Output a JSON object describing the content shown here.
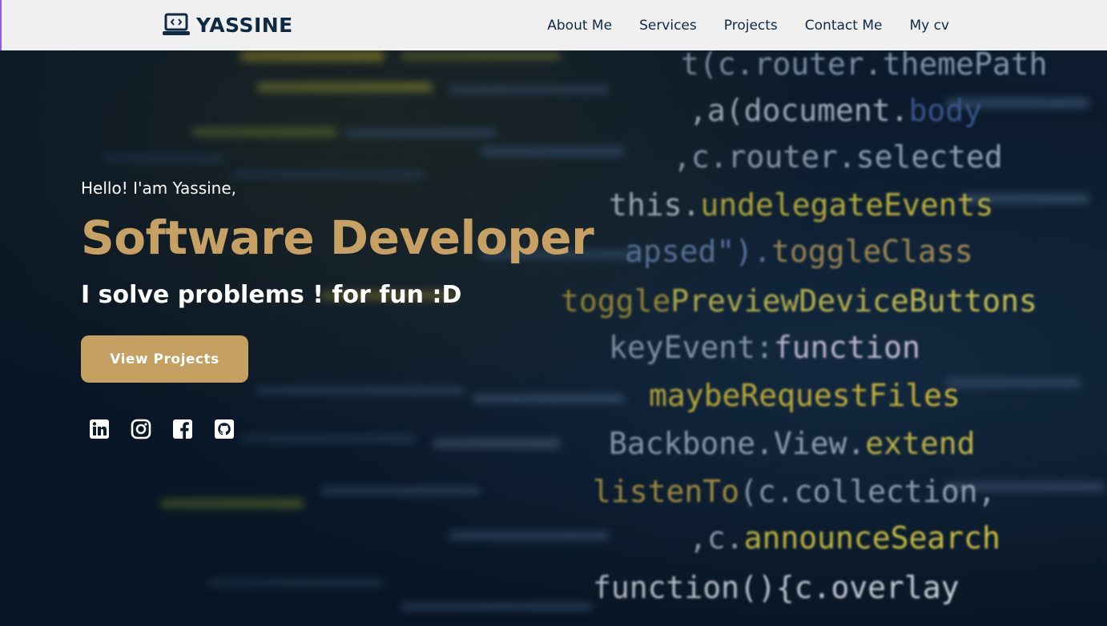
{
  "brand": {
    "name": "YASSINE",
    "icon": "laptop-code-icon"
  },
  "nav": {
    "items": [
      {
        "label": "About Me"
      },
      {
        "label": "Services"
      },
      {
        "label": "Projects"
      },
      {
        "label": "Contact Me"
      },
      {
        "label": "My cv"
      }
    ]
  },
  "hero": {
    "greeting": "Hello! I'am Yassine,",
    "role": "Software Developer",
    "tagline": "I solve problems ! for fun :D",
    "cta_label": "View Projects",
    "socials": [
      {
        "icon": "linkedin-icon"
      },
      {
        "icon": "instagram-icon"
      },
      {
        "icon": "facebook-icon"
      },
      {
        "icon": "github-icon"
      }
    ]
  },
  "colors": {
    "navbar_bg": "#f0f0f0",
    "brand_text": "#102a43",
    "accent_gold": "#c4a062",
    "hero_bg": "#0b1a2c"
  }
}
